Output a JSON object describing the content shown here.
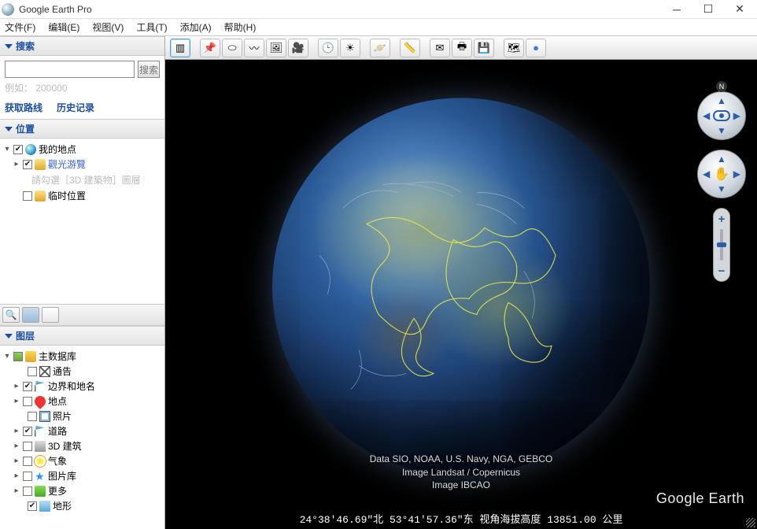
{
  "window": {
    "title": "Google Earth Pro"
  },
  "menu": {
    "file": "文件(F)",
    "edit": "编辑(E)",
    "view": "视图(V)",
    "tools": "工具(T)",
    "add": "添加(A)",
    "help": "帮助(H)"
  },
  "search": {
    "header": "搜索",
    "button": "搜索",
    "placeholder": "",
    "hint": "例如：  200000",
    "route": "获取路线",
    "history": "历史记录"
  },
  "places": {
    "header": "位置",
    "my_places": "我的地点",
    "sightseeing": "觀光游覽",
    "sightseeing_hint": "請勾選［3D 建築物］圖層",
    "temp": "临时位置"
  },
  "layers": {
    "header": "图层",
    "primary_db": "主数据库",
    "items": [
      {
        "label": "通告"
      },
      {
        "label": "边界和地名",
        "checked": true
      },
      {
        "label": "地点"
      },
      {
        "label": "照片"
      },
      {
        "label": "道路",
        "checked": true
      },
      {
        "label": "3D 建筑"
      },
      {
        "label": "气象"
      },
      {
        "label": "图片库"
      },
      {
        "label": "更多"
      },
      {
        "label": "地形",
        "checked": true
      }
    ]
  },
  "attribution": {
    "line1": "Data SIO, NOAA, U.S. Navy, NGA, GEBCO",
    "line2": "Image Landsat / Copernicus",
    "line3": "Image IBCAO"
  },
  "status": "24°38'46.69\"北   53°41'57.36\"东  视角海拔高度 13851.00 公里",
  "watermark": "Google Earth",
  "compass_n": "N"
}
